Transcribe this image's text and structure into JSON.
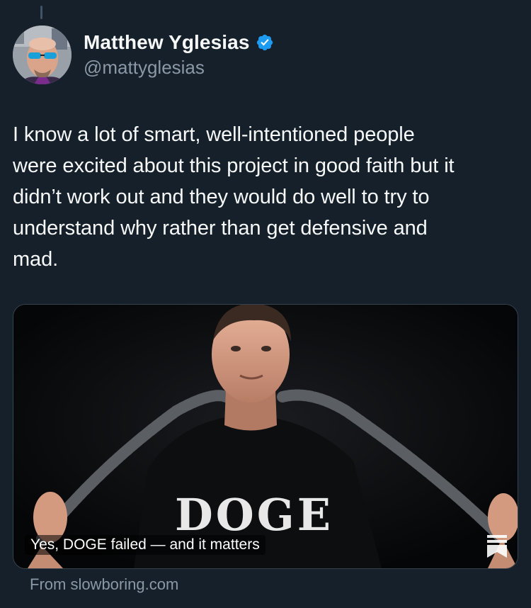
{
  "author": {
    "display_name": "Matthew Yglesias",
    "handle": "@mattyglesias",
    "verified": true
  },
  "tweet": {
    "text_lines": [
      "I know a lot of smart, well-intentioned people",
      "were excited about this project in good faith but it",
      "didn’t work out and they would do well to try to",
      "understand why rather than get defensive and",
      "mad."
    ]
  },
  "link_card": {
    "title": "Yes, DOGE failed — and it matters",
    "shirt_text": "DOGE",
    "source": "From slowboring.com"
  },
  "icons": {
    "verified": "verified-badge-icon",
    "publisher": "substack-bookmark-icon"
  },
  "colors": {
    "background": "#15202b",
    "primary_text": "#f7f9f9",
    "secondary_text": "#8b98a5",
    "verified_blue": "#1d9bf0",
    "border": "#38444d"
  }
}
